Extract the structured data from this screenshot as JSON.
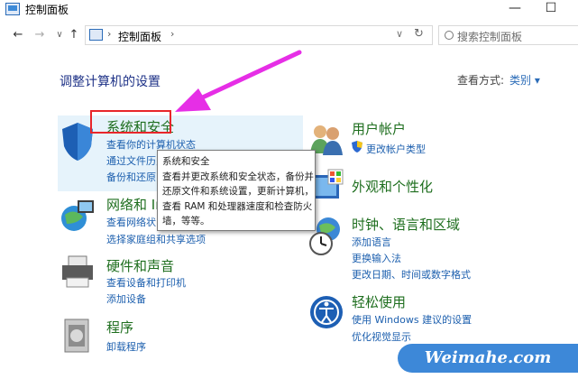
{
  "window": {
    "title": "控制面板",
    "minimize": "—",
    "maximize": "☐"
  },
  "address": {
    "sep": "›",
    "crumb": "控制面板",
    "sep2": "›",
    "dropdown": "∨",
    "refresh": "↻"
  },
  "nav": {
    "back": "←",
    "forward": "→",
    "recent": "∨",
    "up": "↑"
  },
  "search": {
    "placeholder": "搜索控制面板"
  },
  "heading": "调整计算机的设置",
  "view_by": {
    "label": "查看方式:",
    "value": "类别 ▾"
  },
  "left": [
    {
      "title": "系统和安全",
      "links": [
        "查看你的计算机状态",
        "通过文件历史",
        "备份和还原"
      ]
    },
    {
      "title": "网络和 In",
      "links": [
        "查看网络状",
        "选择家庭组和共享选项"
      ]
    },
    {
      "title": "硬件和声音",
      "links": [
        "查看设备和打印机",
        "添加设备"
      ]
    },
    {
      "title": "程序",
      "links": [
        "卸载程序"
      ]
    }
  ],
  "right": [
    {
      "title": "用户帐户",
      "links": [
        "更改帐户类型"
      ]
    },
    {
      "title": "外观和个性化",
      "links": []
    },
    {
      "title": "时钟、语言和区域",
      "links": [
        "添加语言",
        "更换输入法",
        "更改日期、时间或数字格式"
      ]
    },
    {
      "title": "轻松使用",
      "links": [
        "使用 Windows 建议的设置",
        "优化视觉显示"
      ]
    }
  ],
  "tooltip": {
    "lines": [
      "系统和安全",
      "查看并更改系统和安全状态，备份并",
      "还原文件和系统设置，更新计算机，",
      "查看 RAM 和处理器速度和检查防火",
      "墙，等等。"
    ]
  },
  "watermark": "Weimahe.com",
  "colors": {
    "accent": "#1c5fae",
    "category": "#1e6e1e",
    "highlight_box": "#e8262a",
    "arrow": "#e62ee6"
  }
}
